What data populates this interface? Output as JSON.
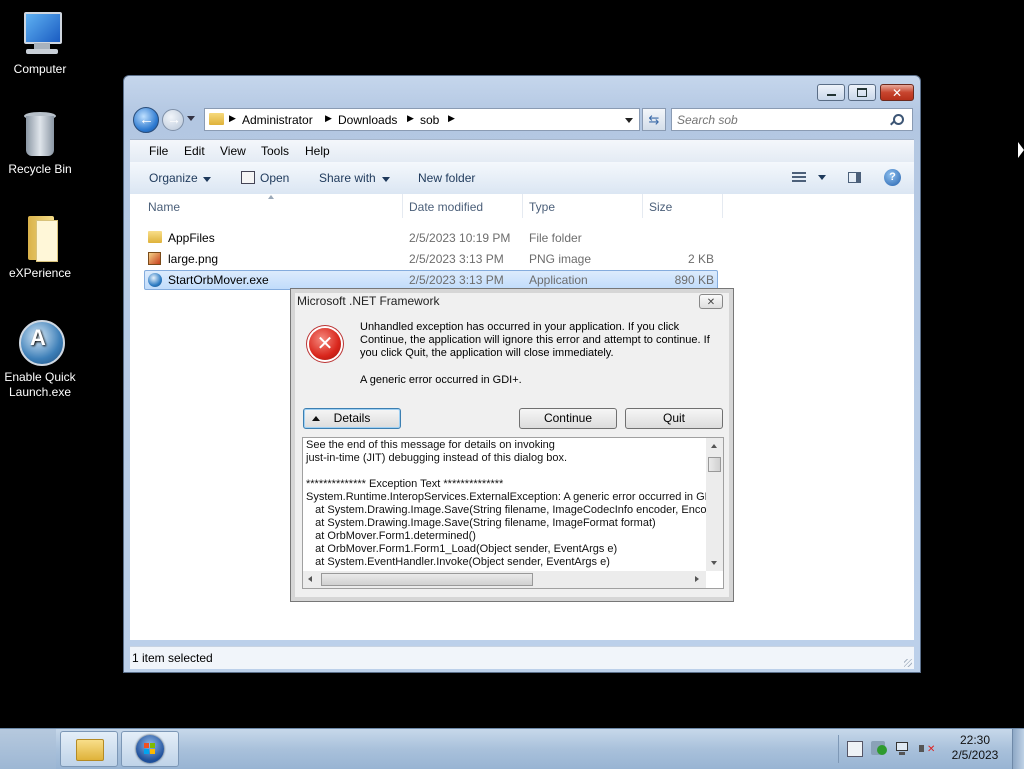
{
  "desktop": {
    "icons": [
      {
        "label": "Computer",
        "icon": "computer-icon"
      },
      {
        "label": "Recycle Bin",
        "icon": "recycle-bin-icon"
      },
      {
        "label": "eXPerience",
        "icon": "folder-icon"
      },
      {
        "label": "Enable Quick Launch.exe",
        "icon": "quick-launch-icon"
      }
    ]
  },
  "explorer": {
    "breadcrumb": [
      "Administrator",
      "Downloads",
      "sob"
    ],
    "search_placeholder": "Search sob",
    "menu": [
      "File",
      "Edit",
      "View",
      "Tools",
      "Help"
    ],
    "toolbar": {
      "organize": "Organize",
      "open": "Open",
      "share_with": "Share with",
      "new_folder": "New folder"
    },
    "columns": {
      "name": "Name",
      "date": "Date modified",
      "type": "Type",
      "size": "Size"
    },
    "files": [
      {
        "name": "AppFiles",
        "date": "2/5/2023 10:19 PM",
        "type": "File folder",
        "size": ""
      },
      {
        "name": "large.png",
        "date": "2/5/2023 3:13 PM",
        "type": "PNG image",
        "size": "2 KB"
      },
      {
        "name": "StartOrbMover.exe",
        "date": "2/5/2023 3:13 PM",
        "type": "Application",
        "size": "890 KB"
      }
    ],
    "status": "1 item selected"
  },
  "dialog": {
    "title": "Microsoft .NET Framework",
    "message": "Unhandled exception has occurred in your application. If you click Continue, the application will ignore this error and attempt to continue. If you click Quit, the application will close immediately.",
    "error": "A generic error occurred in GDI+.",
    "details_label": "Details",
    "continue_label": "Continue",
    "quit_label": "Quit",
    "details_text": "See the end of this message for details on invoking\njust-in-time (JIT) debugging instead of this dialog box.\n\n************** Exception Text **************\nSystem.Runtime.InteropServices.ExternalException: A generic error occurred in GDI+.\n   at System.Drawing.Image.Save(String filename, ImageCodecInfo encoder, EncoderParameters encoderParams)\n   at System.Drawing.Image.Save(String filename, ImageFormat format)\n   at OrbMover.Form1.determined()\n   at OrbMover.Form1.Form1_Load(Object sender, EventArgs e)\n   at System.EventHandler.Invoke(Object sender, EventArgs e)"
  },
  "taskbar": {
    "time": "22:30",
    "date": "2/5/2023"
  },
  "colors": {
    "error_red": "#d9261c",
    "selection": "#c1dcfb",
    "taskbar": "#a9c1db"
  }
}
